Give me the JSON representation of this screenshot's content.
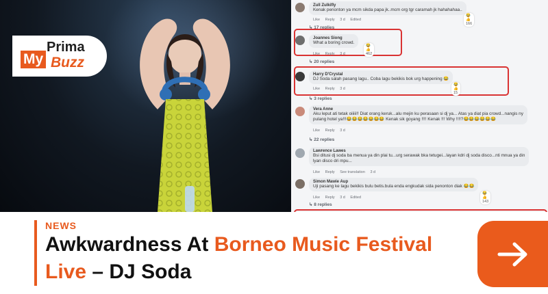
{
  "logo": {
    "prima": "Prima",
    "my": "My",
    "buzz": "Buzz"
  },
  "comments": [
    {
      "author": "Zull Zulkifly",
      "text": "Kenak penonton ya mcm sikda papa jk..mcm org tgr caramah jk hahahahaa..",
      "actions": [
        "Like",
        "Reply",
        "3 d",
        "Edited"
      ],
      "reactions": "166"
    },
    {
      "replies": "17 replies"
    },
    {
      "author": "Joannes Siong",
      "text": "What a boring crowd.",
      "actions": [
        "Like",
        "Reply",
        "3 d"
      ],
      "reactions": "462"
    },
    {
      "replies": "20 replies"
    },
    {
      "author": "Harry D'Crystal",
      "text": "DJ Soda salah pasang lagu.. Coba lagu bekikis bok urg happening 😂",
      "actions": [
        "Like",
        "Reply",
        "3 d"
      ],
      "reactions": "15"
    },
    {
      "replies": "3 replies"
    },
    {
      "author": "Vera Anne",
      "text": "Aku leput ati tetak oiiiii!! Diat orang keruk...alu mejin ku perasaan si dj ya... Atas ya diat pia crowd...nangis ny",
      "text2": "pulang hotel ya!!!😂😂😂😂😂😂😂 Kenak sik goyang !!!! Kenak !!! Why !!!!?😂😂😂😂😂😂",
      "actions": [
        "Like",
        "Reply",
        "3 d"
      ]
    },
    {
      "replies": "22 replies"
    },
    {
      "author": "Lawrence Lawes",
      "text": "Bsi ditusi dj soda ba menua ya din plai tu...urg serawak bka tetugei...layan kdri dj soda disco...nti mnua ya din",
      "text2": "lyan disco dri mpu...",
      "actions": [
        "Like",
        "Reply",
        "See translation",
        "3 d"
      ]
    },
    {
      "author": "Simon Mawie Aup",
      "text": "Uji pasang ke lagu bekikis bulu betis.bula enda engkudak sida penonton diak 😂😂",
      "actions": [
        "Like",
        "Reply",
        "3 d",
        "Edited"
      ],
      "reactions": "143"
    },
    {
      "replies": "8 replies"
    }
  ],
  "article": {
    "tag": "NEWS",
    "headline_part1": "Awkwardness At ",
    "headline_part2": "Borneo Music Festival",
    "headline_part3": "Live",
    "headline_part4": " – DJ Soda"
  },
  "colors": {
    "accent": "#e85a1e",
    "highlight": "#d93232"
  },
  "icons": {
    "arrow": "arrow-right-icon"
  }
}
